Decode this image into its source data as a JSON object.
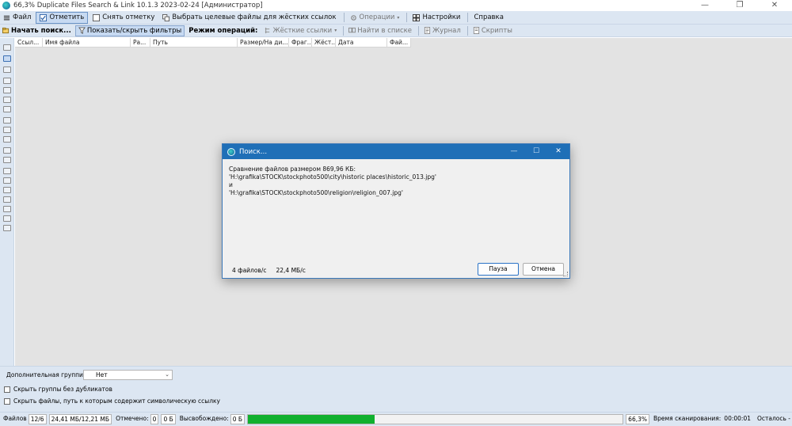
{
  "window": {
    "title": "66,3% Duplicate Files Search & Link 10.1.3 2023-02-24 [Администратор]",
    "minimize": "—",
    "maximize": "❐",
    "close": "✕"
  },
  "menu": {
    "file": "Файл",
    "mark": "Отметить",
    "unmark": "Снять отметку",
    "select_targets": "Выбрать целевые файлы для жёстких ссылок",
    "operations": "Операции",
    "settings": "Настройки",
    "help": "Справка"
  },
  "toolbar": {
    "start_search": "Начать поиск...",
    "toggle_filters": "Показать/скрыть фильтры",
    "mode_label": "Режим операций:",
    "hard_links": "Жёсткие ссылки",
    "find_in_list": "Найти в списке",
    "journal": "Журнал",
    "scripts": "Скрипты"
  },
  "table": {
    "columns": [
      "Ссыл...",
      "Имя файла",
      "Ра...",
      "Путь",
      "Размер/На ди...",
      "Фраг...",
      "Жёст...",
      "Дата",
      "Фай..."
    ]
  },
  "options": {
    "group_label": "Дополнительная группировка по",
    "group_value": "Нет",
    "hide_groups": "Скрыть группы без дубликатов",
    "hide_symlinks": "Скрыть файлы, путь к которым содержит символическую ссылку"
  },
  "status": {
    "files_label": "Файлов",
    "files_value": "12/6",
    "sizes_value": "24,41 МБ/12,21 МБ",
    "marked_label": "Отмечено:",
    "marked_value": "0",
    "marked_size": "0 Б",
    "freed_label": "Высвобождено:",
    "freed_value": "0 Б",
    "progress_fraction": 0.337,
    "percent": "66,3%",
    "scan_time_label": "Время сканирования:",
    "scan_time_value": "00:00:01",
    "remaining_label": "Осталось -"
  },
  "dialog": {
    "title": "Поиск...",
    "line1": "Сравнение файлов размером 869,96 КБ:",
    "line2": "'H:\\grafika\\STOCK\\stockphoto500\\city\\historic places\\historic_013.jpg'",
    "line3": "и",
    "line4": "'H:\\grafika\\STOCK\\stockphoto500\\religion\\religion_007.jpg'",
    "rate_files": "4 файлов/с",
    "rate_speed": "22,4 МБ/с",
    "pause": "Пауза",
    "cancel": "Отмена"
  },
  "colors": {
    "accent": "#1f6fb7",
    "progress": "#10b02e",
    "chrome": "#dce6f2"
  }
}
